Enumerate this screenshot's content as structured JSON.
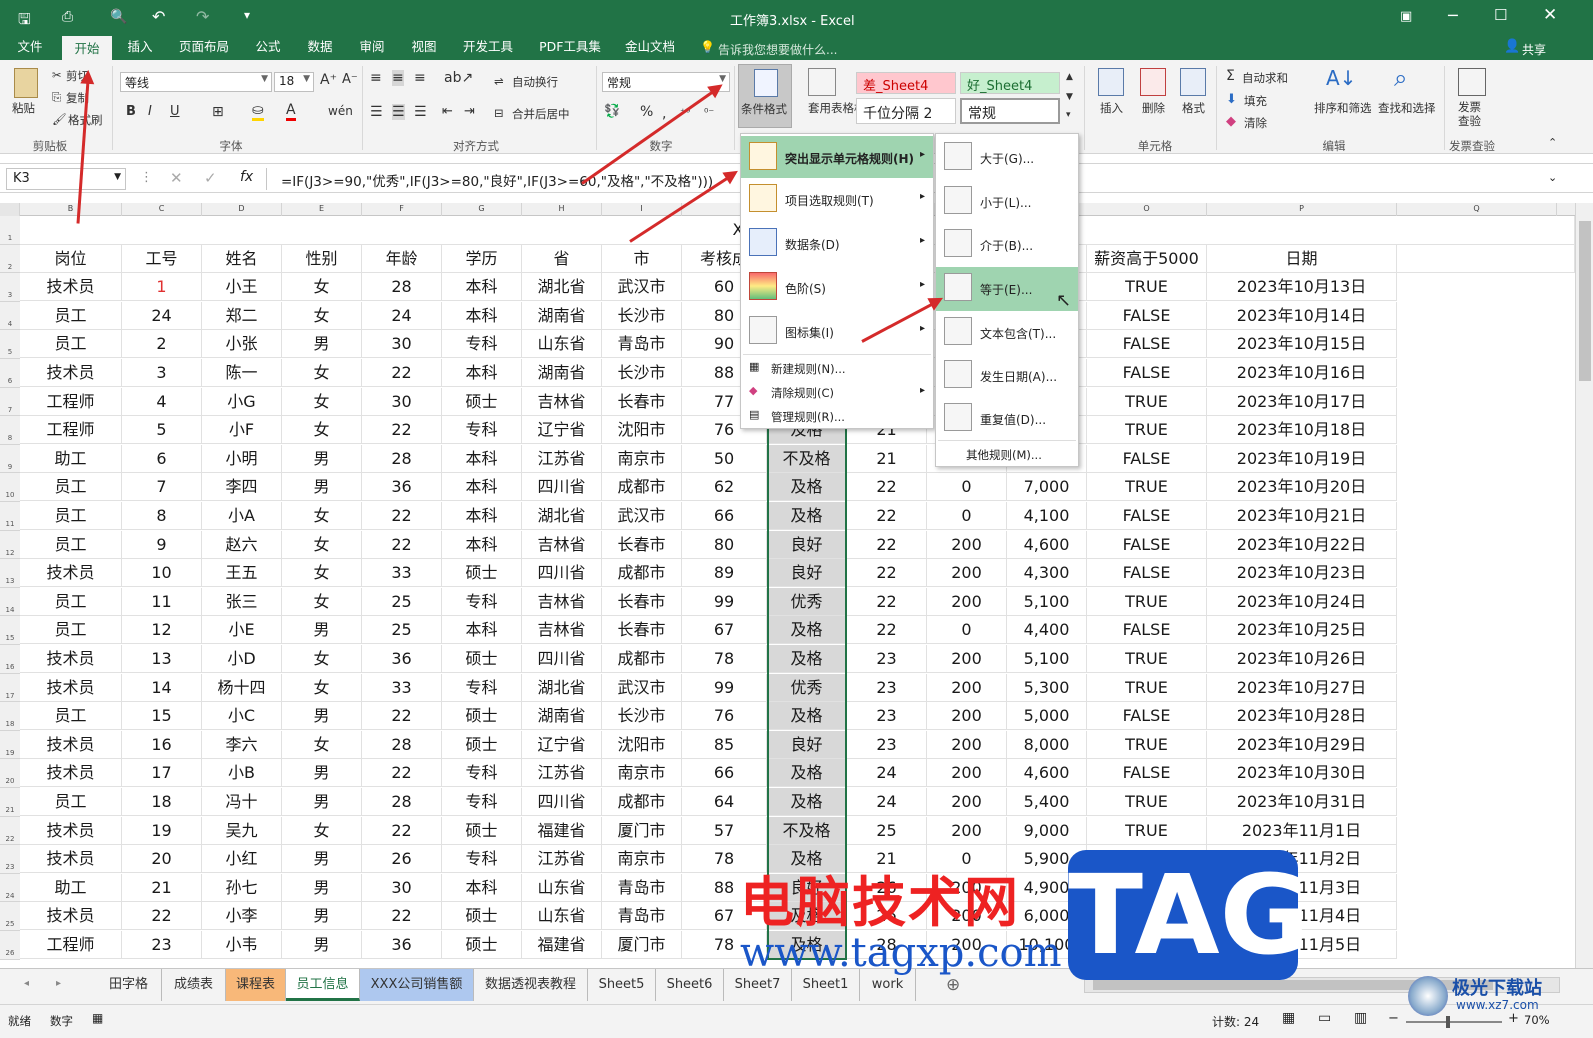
{
  "title": {
    "window": "工作簿3.xlsx - Excel"
  },
  "qat": {
    "save": "保存",
    "undo": "撤销",
    "redo": "恢复"
  },
  "tabs": [
    "文件",
    "开始",
    "插入",
    "页面布局",
    "公式",
    "数据",
    "审阅",
    "视图",
    "开发工具",
    "PDF工具集",
    "金山文档"
  ],
  "tellme": "告诉我您想要做什么...",
  "share": "共享",
  "ribbon": {
    "clipboard": {
      "paste": "粘贴",
      "cut": "剪切",
      "copy": "复制",
      "format_painter": "格式刷",
      "group": "剪贴板"
    },
    "font": {
      "name": "等线",
      "size": "18",
      "group": "字体"
    },
    "align": {
      "wrap": "自动换行",
      "merge": "合并后居中",
      "group": "对齐方式"
    },
    "number": {
      "format": "常规",
      "group": "数字"
    },
    "styles": {
      "cond_format": "条件格式",
      "table_format": "套用表格格式",
      "bad": "差_Sheet4",
      "good": "好_Sheet4",
      "thousands": "千位分隔 2",
      "normal": "常规"
    },
    "cells": {
      "insert": "插入",
      "delete": "删除",
      "format": "格式",
      "group": "单元格"
    },
    "editing": {
      "autosum": "自动求和",
      "fill": "填充",
      "clear": "清除",
      "sort": "排序和筛选",
      "find": "查找和选择",
      "group": "编辑"
    },
    "invoice": {
      "label": "发票查验",
      "group": "发票查验"
    }
  },
  "formula_bar": {
    "name_box": "K3",
    "formula": "=IF(J3>=90,\"优秀\",IF(J3>=80,\"良好\",IF(J3>=60,\"及格\",\"不及格\")))",
    "fx": "fx"
  },
  "sheet": {
    "title": "XXX公司员工信息",
    "headers": [
      "岗位",
      "工号",
      "姓名",
      "性别",
      "年龄",
      "学历",
      "省",
      "市",
      "考核成",
      "",
      "",
      "",
      "",
      "薪资高于5000",
      "日期"
    ],
    "columns": [
      "B",
      "C",
      "D",
      "E",
      "F",
      "G",
      "H",
      "I",
      "",
      "",
      "",
      "",
      "",
      "O",
      "P",
      "Q"
    ],
    "rows": [
      [
        "技术员",
        "1",
        "小王",
        "女",
        "28",
        "本科",
        "湖北省",
        "武汉市",
        "60",
        "",
        "",
        "",
        "",
        "TRUE",
        "2023年10月13日"
      ],
      [
        "员工",
        "24",
        "郑二",
        "女",
        "24",
        "本科",
        "湖南省",
        "长沙市",
        "80",
        "",
        "",
        "",
        "",
        "FALSE",
        "2023年10月14日"
      ],
      [
        "员工",
        "2",
        "小张",
        "男",
        "30",
        "专科",
        "山东省",
        "青岛市",
        "90",
        "",
        "",
        "",
        "",
        "FALSE",
        "2023年10月15日"
      ],
      [
        "技术员",
        "3",
        "陈一",
        "女",
        "22",
        "本科",
        "湖南省",
        "长沙市",
        "88",
        "",
        "",
        "",
        "",
        "FALSE",
        "2023年10月16日"
      ],
      [
        "工程师",
        "4",
        "小G",
        "女",
        "30",
        "硕士",
        "吉林省",
        "长春市",
        "77",
        "",
        "",
        "",
        "",
        "TRUE",
        "2023年10月17日"
      ],
      [
        "工程师",
        "5",
        "小F",
        "女",
        "22",
        "专科",
        "辽宁省",
        "沈阳市",
        "76",
        "及格",
        "21",
        "",
        "",
        "TRUE",
        "2023年10月18日"
      ],
      [
        "助工",
        "6",
        "小明",
        "男",
        "28",
        "本科",
        "江苏省",
        "南京市",
        "50",
        "不及格",
        "21",
        "",
        "",
        "FALSE",
        "2023年10月19日"
      ],
      [
        "员工",
        "7",
        "李四",
        "男",
        "36",
        "本科",
        "四川省",
        "成都市",
        "62",
        "及格",
        "22",
        "0",
        "7,000",
        "TRUE",
        "2023年10月20日"
      ],
      [
        "员工",
        "8",
        "小A",
        "女",
        "22",
        "本科",
        "湖北省",
        "武汉市",
        "66",
        "及格",
        "22",
        "0",
        "4,100",
        "FALSE",
        "2023年10月21日"
      ],
      [
        "员工",
        "9",
        "赵六",
        "女",
        "22",
        "本科",
        "吉林省",
        "长春市",
        "80",
        "良好",
        "22",
        "200",
        "4,600",
        "FALSE",
        "2023年10月22日"
      ],
      [
        "技术员",
        "10",
        "王五",
        "女",
        "33",
        "硕士",
        "四川省",
        "成都市",
        "89",
        "良好",
        "22",
        "200",
        "4,300",
        "FALSE",
        "2023年10月23日"
      ],
      [
        "员工",
        "11",
        "张三",
        "女",
        "25",
        "专科",
        "吉林省",
        "长春市",
        "99",
        "优秀",
        "22",
        "200",
        "5,100",
        "TRUE",
        "2023年10月24日"
      ],
      [
        "员工",
        "12",
        "小E",
        "男",
        "25",
        "本科",
        "吉林省",
        "长春市",
        "67",
        "及格",
        "22",
        "0",
        "4,400",
        "FALSE",
        "2023年10月25日"
      ],
      [
        "技术员",
        "13",
        "小D",
        "女",
        "36",
        "硕士",
        "四川省",
        "成都市",
        "78",
        "及格",
        "23",
        "200",
        "5,100",
        "TRUE",
        "2023年10月26日"
      ],
      [
        "技术员",
        "14",
        "杨十四",
        "女",
        "33",
        "专科",
        "湖北省",
        "武汉市",
        "99",
        "优秀",
        "23",
        "200",
        "5,300",
        "TRUE",
        "2023年10月27日"
      ],
      [
        "员工",
        "15",
        "小C",
        "男",
        "22",
        "硕士",
        "湖南省",
        "长沙市",
        "76",
        "及格",
        "23",
        "200",
        "5,000",
        "FALSE",
        "2023年10月28日"
      ],
      [
        "技术员",
        "16",
        "李六",
        "女",
        "28",
        "硕士",
        "辽宁省",
        "沈阳市",
        "85",
        "良好",
        "23",
        "200",
        "8,000",
        "TRUE",
        "2023年10月29日"
      ],
      [
        "技术员",
        "17",
        "小B",
        "男",
        "22",
        "专科",
        "江苏省",
        "南京市",
        "66",
        "及格",
        "24",
        "200",
        "4,600",
        "FALSE",
        "2023年10月30日"
      ],
      [
        "员工",
        "18",
        "冯十",
        "男",
        "28",
        "专科",
        "四川省",
        "成都市",
        "64",
        "及格",
        "24",
        "200",
        "5,400",
        "TRUE",
        "2023年10月31日"
      ],
      [
        "技术员",
        "19",
        "吴九",
        "女",
        "22",
        "硕士",
        "福建省",
        "厦门市",
        "57",
        "不及格",
        "25",
        "200",
        "9,000",
        "TRUE",
        "2023年11月1日"
      ],
      [
        "技术员",
        "20",
        "小红",
        "男",
        "26",
        "专科",
        "江苏省",
        "南京市",
        "78",
        "及格",
        "21",
        "0",
        "5,900",
        "TRUE",
        "2023年11月2日"
      ],
      [
        "助工",
        "21",
        "孙七",
        "男",
        "30",
        "本科",
        "山东省",
        "青岛市",
        "88",
        "良好",
        "26",
        "200",
        "4,900",
        "FALSE",
        "2023年11月3日"
      ],
      [
        "技术员",
        "22",
        "小李",
        "男",
        "22",
        "硕士",
        "山东省",
        "青岛市",
        "67",
        "及格",
        "26",
        "200",
        "6,000",
        "TRUE",
        "2023年11月4日"
      ],
      [
        "工程师",
        "23",
        "小韦",
        "男",
        "36",
        "硕士",
        "福建省",
        "厦门市",
        "78",
        "及格",
        "28",
        "200",
        "10,100",
        "TRUE",
        "2023年11月5日"
      ]
    ]
  },
  "cf_menu": [
    {
      "label": "突出显示单元格规则(H)",
      "arrow": "▸"
    },
    {
      "label": "项目选取规则(T)",
      "arrow": "▸"
    },
    {
      "label": "数据条(D)",
      "arrow": "▸"
    },
    {
      "label": "色阶(S)",
      "arrow": "▸"
    },
    {
      "label": "图标集(I)",
      "arrow": "▸"
    },
    {
      "label": "新建规则(N)..."
    },
    {
      "label": "清除规则(C)",
      "arrow": "▸"
    },
    {
      "label": "管理规则(R)..."
    }
  ],
  "sub_menu": [
    {
      "label": "大于(G)..."
    },
    {
      "label": "小于(L)..."
    },
    {
      "label": "介于(B)..."
    },
    {
      "label": "等于(E)..."
    },
    {
      "label": "文本包含(T)..."
    },
    {
      "label": "发生日期(A)..."
    },
    {
      "label": "重复值(D)..."
    },
    {
      "label": "其他规则(M)..."
    }
  ],
  "sheet_tabs": [
    "田字格",
    "成绩表",
    "课程表",
    "员工信息",
    "XXX公司销售额",
    "数据透视表教程",
    "Sheet5",
    "Sheet6",
    "Sheet7",
    "Sheet1",
    "work"
  ],
  "status": {
    "ready": "就绪",
    "num": "数字",
    "count": "计数: 24",
    "zoom": "70%"
  },
  "watermark": {
    "cn": "电脑技术网",
    "url": "www.tagxp.com",
    "tag": "TAG",
    "site1": "极光下载站",
    "site2": "www.xz7.com"
  },
  "colors": {
    "excel_green": "#217346",
    "menu_highlight": "#9fd4b0",
    "arrow": "#d42a2a",
    "bad_fill": "#ffc7ce",
    "good_fill": "#c6efce"
  }
}
